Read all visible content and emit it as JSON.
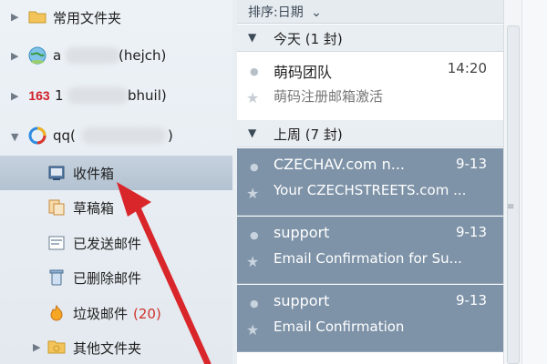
{
  "folders_top": {
    "common_folders_label": "常用文件夹"
  },
  "accounts": [
    {
      "label_visible": "a",
      "label_suffix": "(hejch)",
      "icon": "globe-icon"
    },
    {
      "label_prefix": "1",
      "label_suffix": "bhuil)",
      "icon": "163-icon",
      "icon_text": "163"
    },
    {
      "label_prefix": "qq(",
      "label_suffix": ")",
      "icon": "qq-ring-icon"
    }
  ],
  "folders": [
    {
      "label": "收件箱",
      "icon": "inbox-icon",
      "selected": true
    },
    {
      "label": "草稿箱",
      "icon": "drafts-icon"
    },
    {
      "label": "已发送邮件",
      "icon": "sent-icon"
    },
    {
      "label": "已删除邮件",
      "icon": "trash-icon"
    },
    {
      "label": "垃圾邮件",
      "icon": "spam-icon",
      "count": "(20)"
    },
    {
      "label": "其他文件夹",
      "icon": "folder-icon"
    }
  ],
  "sort_bar": {
    "label": "排序:日期",
    "chevron": "⌄"
  },
  "groups": [
    {
      "label": "今天 (1 封)"
    },
    {
      "label": "上周 (7 封)"
    }
  ],
  "mails": [
    {
      "sender": "萌码团队",
      "date": "14:20",
      "subject": "萌码注册邮箱激活",
      "selected": false
    },
    {
      "sender": "CZECHAV.com n...",
      "date": "9-13",
      "subject": "Your CZECHSTREETS.com ...",
      "selected": true
    },
    {
      "sender": "support",
      "date": "9-13",
      "subject": "Email Confirmation for Su...",
      "selected": true
    },
    {
      "sender": "support",
      "date": "9-13",
      "subject": "Email Confirmation",
      "selected": true
    }
  ],
  "colors": {
    "selection": "#7e93a8",
    "arrow": "#d9262a",
    "count": "#d0322b"
  }
}
